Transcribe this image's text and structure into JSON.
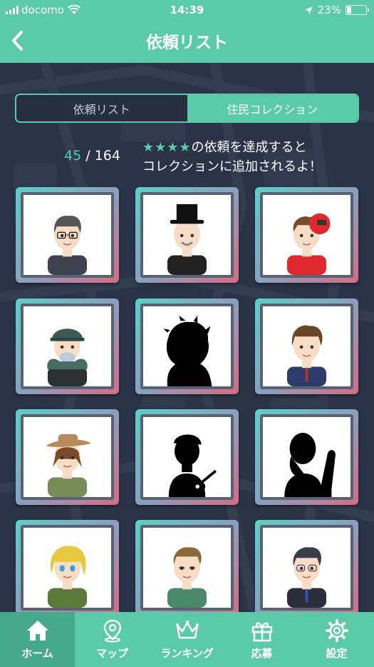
{
  "status_bar": {
    "carrier": "docomo",
    "time": "14:39",
    "battery": "23%",
    "battery_level": 0.23
  },
  "header": {
    "title": "依頼リスト"
  },
  "tabs": [
    {
      "label": "依頼リスト",
      "active": false
    },
    {
      "label": "住民コレクション",
      "active": true
    }
  ],
  "collection": {
    "collected": "45",
    "separator": "/",
    "total": "164",
    "notice_stars": "★★★★",
    "notice_line1_suffix": "の依頼を達成すると",
    "notice_line2": "コレクションに追加されるよ！"
  },
  "residents": [
    {
      "type": "glasses-man",
      "unlocked": true
    },
    {
      "type": "tophat-man",
      "unlocked": true
    },
    {
      "type": "racer-boy",
      "unlocked": true
    },
    {
      "type": "cap-mask-man",
      "unlocked": true
    },
    {
      "type": "shaggy",
      "unlocked": false
    },
    {
      "type": "brown-hair-man",
      "unlocked": true
    },
    {
      "type": "hat-boy",
      "unlocked": true
    },
    {
      "type": "guitar-boy",
      "unlocked": false
    },
    {
      "type": "waving-girl",
      "unlocked": false
    },
    {
      "type": "blonde-girl",
      "unlocked": true
    },
    {
      "type": "smiling-boy",
      "unlocked": true
    },
    {
      "type": "glasses-suit-man",
      "unlocked": true
    }
  ],
  "nav": [
    {
      "label": "ホーム",
      "icon": "home-icon",
      "active": true
    },
    {
      "label": "マップ",
      "icon": "map-pin-icon",
      "active": false
    },
    {
      "label": "ランキング",
      "icon": "crown-icon",
      "active": false
    },
    {
      "label": "応募",
      "icon": "gift-icon",
      "active": false
    },
    {
      "label": "設定",
      "icon": "gear-icon",
      "active": false
    }
  ],
  "colors": {
    "accent": "#5bcba7",
    "background": "#2a3347",
    "nav_active": "#45a98a"
  }
}
